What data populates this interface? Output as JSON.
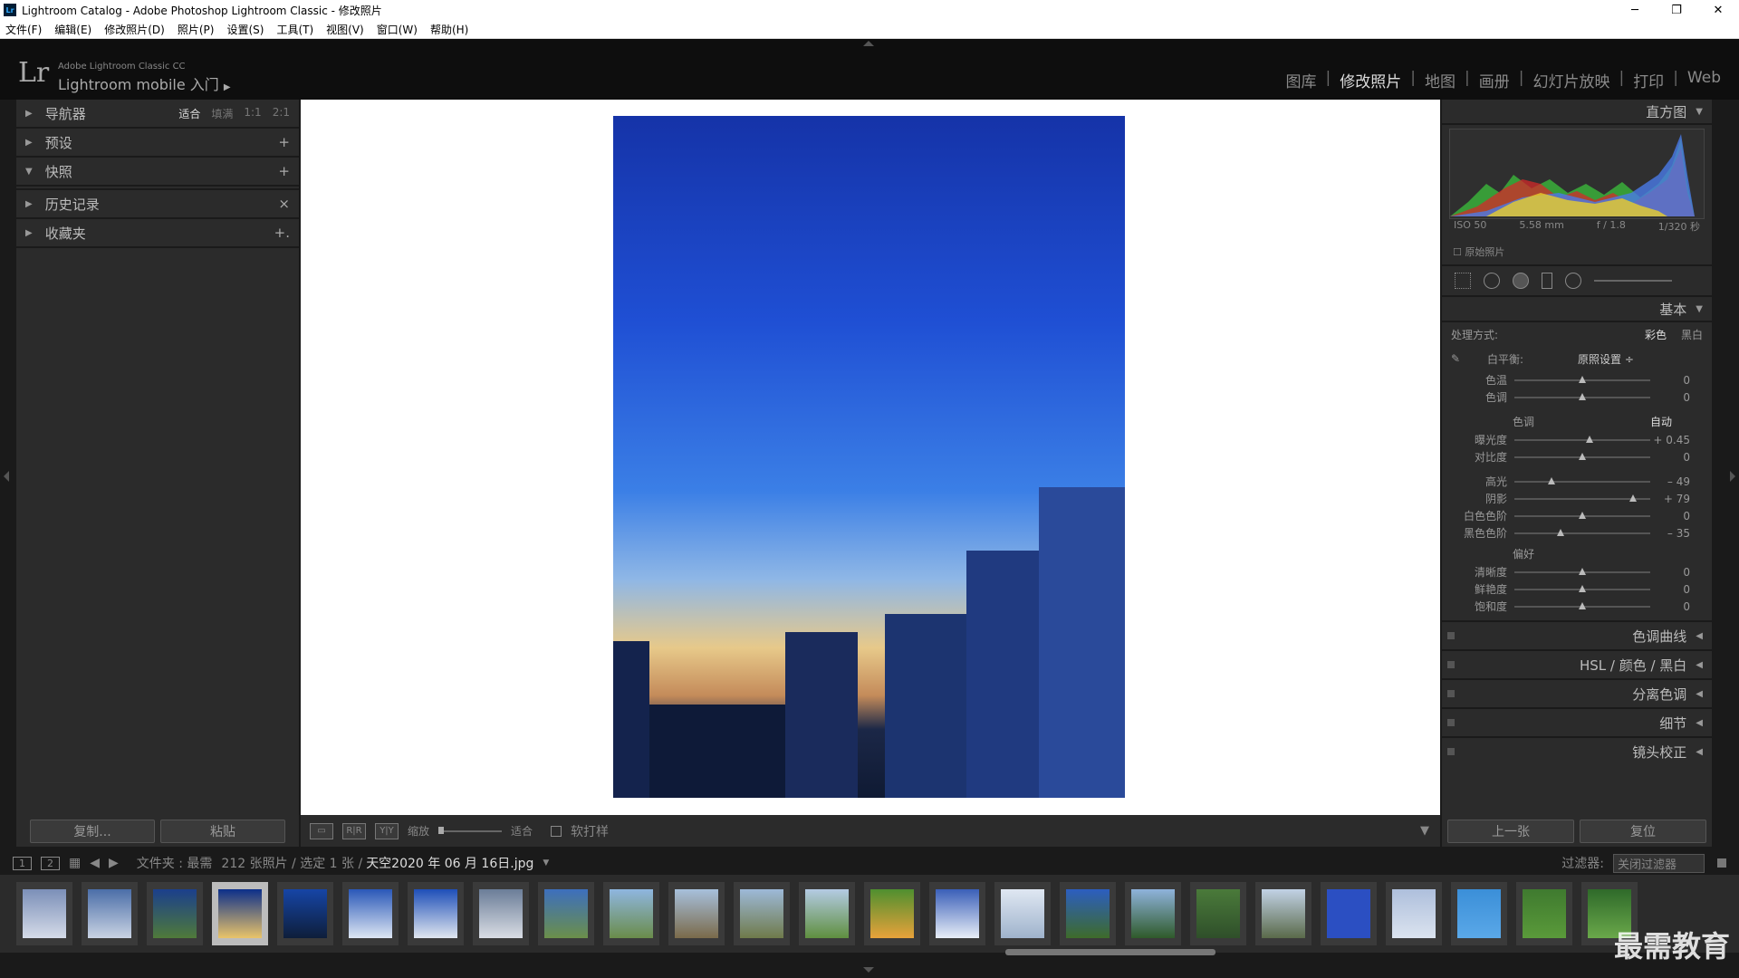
{
  "window": {
    "title": "Lightroom Catalog - Adobe Photoshop Lightroom Classic - 修改照片",
    "app_icon": "Lr"
  },
  "menu": [
    "文件(F)",
    "编辑(E)",
    "修改照片(D)",
    "照片(P)",
    "设置(S)",
    "工具(T)",
    "视图(V)",
    "窗口(W)",
    "帮助(H)"
  ],
  "identity": {
    "logo": "Lr",
    "line1": "Adobe Lightroom Classic CC",
    "line2": "Lightroom mobile 入门",
    "arrow": "▶"
  },
  "modules": [
    "图库",
    "修改照片",
    "地图",
    "画册",
    "幻灯片放映",
    "打印",
    "Web"
  ],
  "left_panel": {
    "navigator": {
      "label": "导航器",
      "options": [
        "适合",
        "填满",
        "1:1",
        "2:1"
      ]
    },
    "sections": [
      {
        "label": "预设",
        "action": "+"
      },
      {
        "label": "快照",
        "action": "+"
      },
      {
        "label": "历史记录",
        "action": "×"
      },
      {
        "label": "收藏夹",
        "action": "+."
      }
    ],
    "buttons": [
      "复制...",
      "粘贴"
    ]
  },
  "toolbar": {
    "zoom_label": "缩放",
    "zoom_value": "适合",
    "softproof": "软打样"
  },
  "right_panel": {
    "histogram": {
      "title": "直方图",
      "iso": "ISO 50",
      "focal": "5.58 mm",
      "aperture": "f / 1.8",
      "shutter": "1/320 秒",
      "original": "原始照片"
    },
    "basic": {
      "title": "基本",
      "treatment_label": "处理方式:",
      "color": "彩色",
      "bw": "黑白",
      "wb_label": "白平衡:",
      "wb_value": "原照设置 ÷",
      "sliders1": [
        {
          "label": "色温",
          "value": "0",
          "pos": 0.5
        },
        {
          "label": "色调",
          "value": "0",
          "pos": 0.5
        }
      ],
      "tone_label": "色调",
      "auto": "自动",
      "sliders2": [
        {
          "label": "曝光度",
          "value": "+ 0.45",
          "pos": 0.55
        },
        {
          "label": "对比度",
          "value": "0",
          "pos": 0.5
        }
      ],
      "sliders3": [
        {
          "label": "高光",
          "value": "– 49",
          "pos": 0.27
        },
        {
          "label": "阴影",
          "value": "+ 79",
          "pos": 0.87
        },
        {
          "label": "白色色阶",
          "value": "0",
          "pos": 0.5
        },
        {
          "label": "黑色色阶",
          "value": "– 35",
          "pos": 0.34
        }
      ],
      "presence_label": "偏好",
      "sliders4": [
        {
          "label": "清晰度",
          "value": "0",
          "pos": 0.5
        },
        {
          "label": "鲜艳度",
          "value": "0",
          "pos": 0.5
        },
        {
          "label": "饱和度",
          "value": "0",
          "pos": 0.5
        }
      ]
    },
    "collapsed": [
      "色调曲线",
      "HSL  /  颜色  /  黑白",
      "分离色调",
      "细节",
      "镜头校正"
    ],
    "buttons": [
      "上一张",
      "复位"
    ]
  },
  "filmstrip": {
    "views": [
      "1",
      "2"
    ],
    "source": "文件夹 : 最需",
    "count": "212 张照片 / 选定 1 张 /",
    "filename": "天空2020 年 06 月 16日.jpg",
    "filter_label": "过滤器:",
    "filter_value": "关闭过滤器",
    "thumbs": [
      {
        "c1": "#7b8fb8",
        "c2": "#d5dbe8"
      },
      {
        "c1": "#4b6ea8",
        "c2": "#c9d3e3"
      },
      {
        "c1": "#1b3f8c",
        "c2": "#4f7a3a"
      },
      {
        "c1": "#0c2f8a",
        "c2": "#e9c46a"
      },
      {
        "c1": "#1645a6",
        "c2": "#0e1e3a"
      },
      {
        "c1": "#2a58b8",
        "c2": "#dde6f3"
      },
      {
        "c1": "#1e4fb8",
        "c2": "#e0e6ef"
      },
      {
        "c1": "#6b7d98",
        "c2": "#d9dde4"
      },
      {
        "c1": "#3d6fbd",
        "c2": "#6b8f4a"
      },
      {
        "c1": "#8fb6e0",
        "c2": "#6a8c4a"
      },
      {
        "c1": "#a7c0dc",
        "c2": "#7a6a4a"
      },
      {
        "c1": "#9db9d8",
        "c2": "#6f7a4a"
      },
      {
        "c1": "#b4cbe4",
        "c2": "#5f8f3f"
      },
      {
        "c1": "#4f8f2f",
        "c2": "#e8a23a"
      },
      {
        "c1": "#3a5fb8",
        "c2": "#e8eef7"
      },
      {
        "c1": "#dfe7f2",
        "c2": "#9fb3cc"
      },
      {
        "c1": "#2c5ec0",
        "c2": "#3e6b2a"
      },
      {
        "c1": "#8fb3dc",
        "c2": "#2f5a2a"
      },
      {
        "c1": "#4a7a3a",
        "c2": "#2f4f2a"
      },
      {
        "c1": "#c2d2e6",
        "c2": "#5a6a4a"
      },
      {
        "c1": "#2b4fc2",
        "c2": "#2b4fc2"
      },
      {
        "c1": "#aebfdc",
        "c2": "#dbe3ef"
      },
      {
        "c1": "#3b8fd8",
        "c2": "#5aa8e8"
      },
      {
        "c1": "#3f7a2f",
        "c2": "#5a9a3a"
      },
      {
        "c1": "#2f6a2a",
        "c2": "#6aa84a"
      },
      {
        "c1": "#c9d7e8",
        "c2": "#8fa3bf"
      }
    ]
  },
  "watermark": "最需教育"
}
